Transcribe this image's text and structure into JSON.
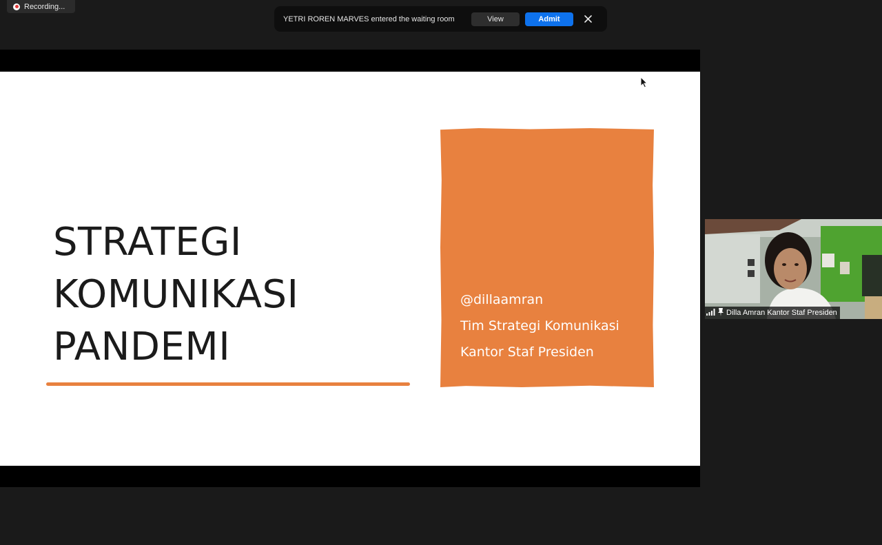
{
  "recording": {
    "label": "Recording..."
  },
  "notification": {
    "message": "YETRI ROREN MARVES entered the waiting room",
    "view_label": "View",
    "admit_label": "Admit",
    "accent_color": "#0e72ed"
  },
  "slide": {
    "title_lines": [
      "STRATEGI",
      "KOMUNIKASI",
      "PANDEMI"
    ],
    "box_lines": [
      "@dillaamran",
      "Tim Strategi Komunikasi",
      "Kantor Staf Presiden"
    ],
    "accent_color": "#e8813f"
  },
  "slide_controls": [
    "arrow-left-icon",
    "pen-icon",
    "whiteboard-icon",
    "more-icon",
    "arrow-right-icon"
  ],
  "participant": {
    "name": "Dilla Amran Kantor Staf Presiden"
  }
}
